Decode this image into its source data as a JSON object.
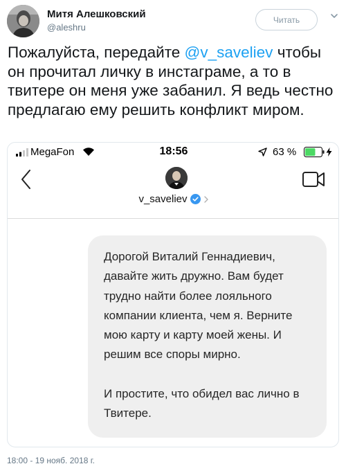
{
  "tweet": {
    "author_name": "Митя Алешковский",
    "author_handle": "@aleshru",
    "follow_label": "Читать",
    "text_before": "Пожалуйста, передайте ",
    "mention": "@v_saveliev",
    "text_after": " чтобы он прочитал личку в инстаграме, а то в твитере он меня уже забанил. Я ведь честно предлагаю ему решить конфликт миром.",
    "timestamp": "18:00 - 19 нояб. 2018 г."
  },
  "phone": {
    "carrier": "MegaFon",
    "time": "18:56",
    "battery_pct": "63 %",
    "battery_level": 0.63,
    "battery_color": "#4cd964"
  },
  "instagram": {
    "username": "v_saveliev",
    "verified_color": "#3897f0",
    "message_p1": "Дорогой Виталий Геннадиевич, давайте жить дружно. Вам будет трудно найти более лояльного компании клиента, чем я. Верните мою карту и карту моей жены. И решим все споры мирно.",
    "message_p2": "И простите, что обидел вас лично в Твитере."
  },
  "icons": [
    "avatar",
    "caret-down-icon",
    "signal-icon",
    "wifi-icon",
    "location-arrow-icon",
    "battery-icon",
    "charging-bolt-icon",
    "back-chevron-icon",
    "verified-badge-icon",
    "chevron-right-icon",
    "video-camera-icon"
  ],
  "colors": {
    "accent": "#1da1f2",
    "muted": "#657786"
  }
}
